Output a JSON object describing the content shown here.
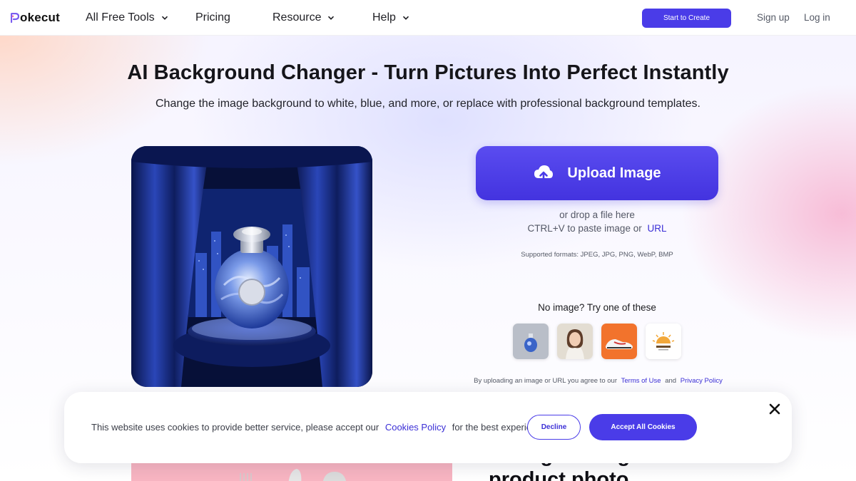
{
  "nav": {
    "logo_text": "okecut",
    "logo_icon": "pokecut-logo-mark",
    "items": [
      {
        "label": "All Free Tools",
        "has_dropdown": true
      },
      {
        "label": "Pricing",
        "has_dropdown": false
      },
      {
        "label": "Resource",
        "has_dropdown": true
      },
      {
        "label": "Help",
        "has_dropdown": true
      }
    ],
    "start_button": "Start to Create",
    "signup": "Sign up",
    "login": "Log in"
  },
  "hero": {
    "title": "AI Background Changer - Turn Pictures Into Perfect Instantly",
    "subtitle": "Change the image background to white, blue, and more, or replace with professional background templates."
  },
  "upload": {
    "button_label": "Upload Image",
    "button_icon": "cloud-upload-icon",
    "drop_text": "or drop a file here",
    "paste_text": "CTRL+V to paste image or",
    "url_link": "URL",
    "formats": "Supported formats: JPEG, JPG, PNG, WebP, BMP",
    "try_text": "No image? Try one of these",
    "samples": [
      {
        "name": "perfume-bottle"
      },
      {
        "name": "woman-portrait"
      },
      {
        "name": "sneaker"
      },
      {
        "name": "logo-sunrise"
      }
    ],
    "agree_text": "By uploading an image or URL you agree to our",
    "terms_link": "Terms of Use",
    "and_text": "and",
    "privacy_link": "Privacy Policy"
  },
  "below": {
    "heading": "Change background of product photo"
  },
  "cookie": {
    "text": "This website uses cookies to provide better service, please accept our",
    "policy_link": "Cookies Policy",
    "text_end": "for the best experience",
    "decline": "Decline",
    "accept": "Accept All Cookies"
  },
  "colors": {
    "accent": "#4a3ce8",
    "link": "#3b2fd6"
  }
}
